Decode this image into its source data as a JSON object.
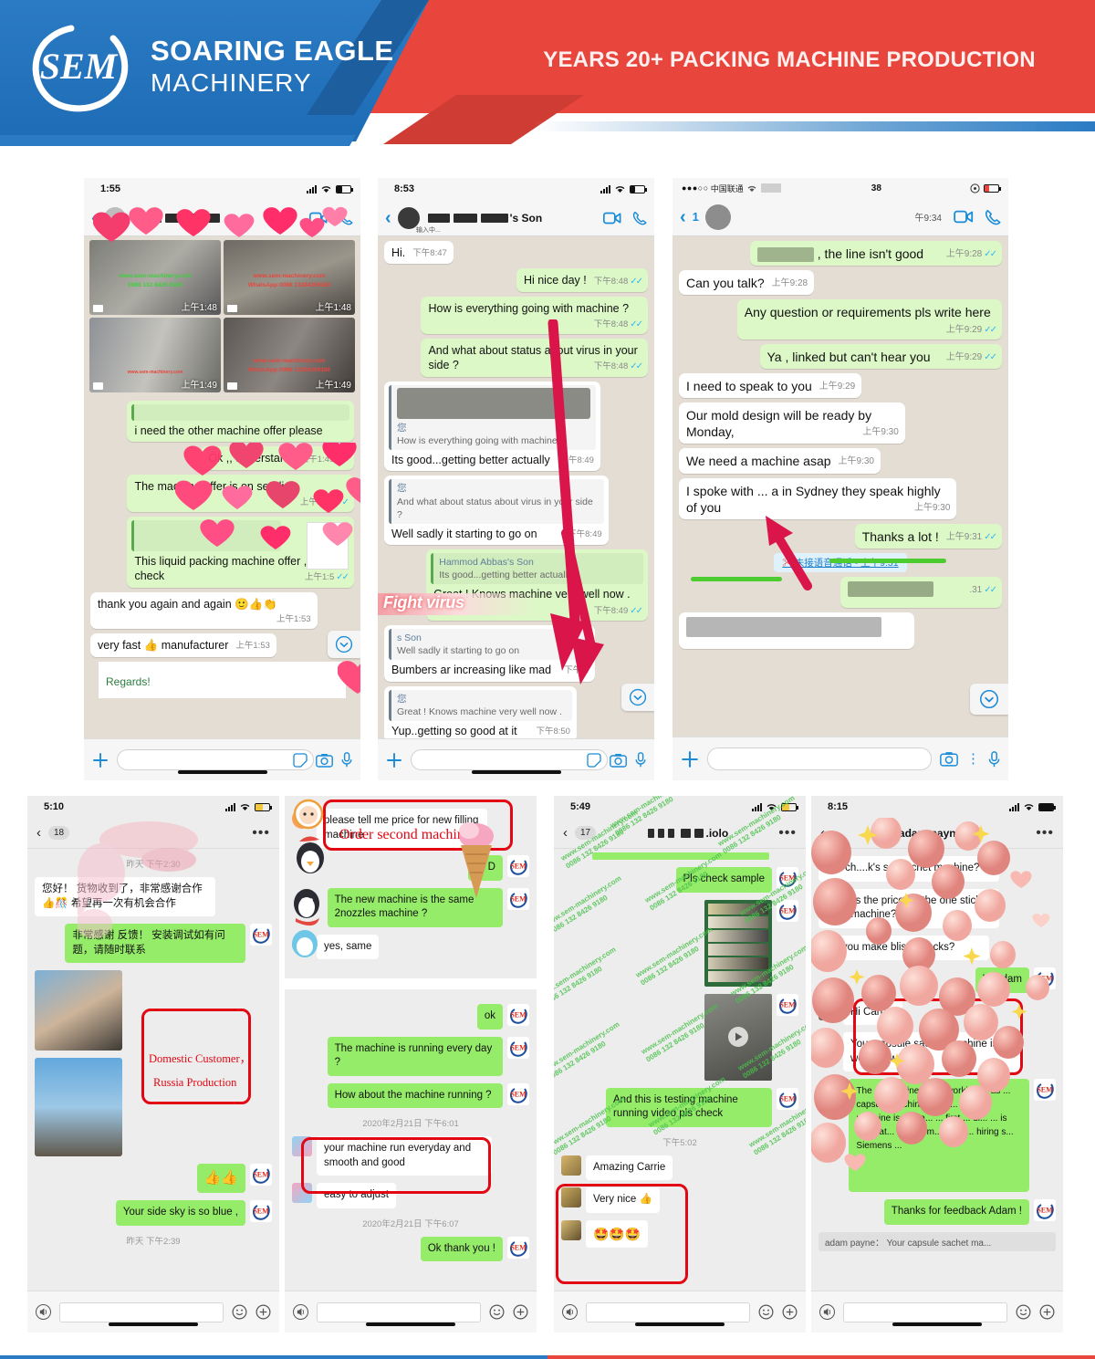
{
  "header": {
    "brand_line1": "SOARING EAGLE",
    "brand_line2": "MACHINERY",
    "logo_text": "SEM",
    "tagline": "YEARS 20+ PACKING MACHINE PRODUCTION",
    "colors": {
      "blue": "#2b7bc4",
      "blue_dark": "#1c5e9e",
      "red": "#e8453c",
      "red_dark": "#cf3c34"
    }
  },
  "watermark": {
    "site": "www.sem-machinery.com",
    "phone": "0086 132 8426 9180",
    "whatsapp": "WhatsApp:0086 13284269180"
  },
  "phones": [
    {
      "id": "phone1",
      "status": {
        "time": "1:55",
        "battery": "low"
      },
      "nav": {
        "back": "‹",
        "title_redacted": true,
        "icons": [
          "video-call-icon",
          "phone-call-icon"
        ]
      },
      "media": [
        {
          "time": "上午1:48",
          "wm1": "www.sem-machinery.com",
          "wm2": "0086 132 8426 9180"
        },
        {
          "time": "上午1:48",
          "wm1": "www.sem-machinery.com",
          "wm2": "WhatsApp:0086 13284269180"
        },
        {
          "time": "上午1:49",
          "wm1": "www.sem-machinery.com",
          "wm2": "0086 132 8426 9180"
        },
        {
          "time": "上午1:49",
          "wm1": "www.sem-machinery.com",
          "wm2": "WhatsApp:0086 13284269180"
        }
      ],
      "messages": [
        {
          "side": "out",
          "quote": "i need the other machine offer please",
          "text": "",
          "time": ""
        },
        {
          "side": "out",
          "text": "Ok ,, understand",
          "time": "上午1:49",
          "ticks": true
        },
        {
          "side": "out",
          "text": "The machine offer is on sending",
          "time": "上午1:49",
          "ticks": true
        },
        {
          "side": "out",
          "text": "This liquid packing machine offer , pls check",
          "time": "上午1:5",
          "ticks": true,
          "has_doc": true
        },
        {
          "side": "in",
          "text": "thank you again and again  🙂👍👏",
          "time": "上午1:53"
        },
        {
          "side": "in",
          "text": "very fast 👍 manufacturer",
          "time": "上午1:53"
        },
        {
          "side": "in",
          "text": "Regards!",
          "time": "",
          "is_doc_preview": true
        }
      ]
    },
    {
      "id": "phone2",
      "status": {
        "time": "8:53",
        "battery": "low"
      },
      "nav": {
        "back": "‹",
        "title": "'s Son",
        "subtitle": "输入中...",
        "icons": [
          "video-call-icon",
          "phone-call-icon"
        ]
      },
      "annotation": {
        "fight_virus": "Fight virus"
      },
      "messages": [
        {
          "side": "in",
          "text": "Hi.",
          "time": "下午8:47"
        },
        {
          "side": "out",
          "text": "Hi nice day !",
          "time": "下午8:48",
          "ticks": true
        },
        {
          "side": "out",
          "text": "How is everything going with machine ?",
          "time": "下午8:48",
          "ticks": true
        },
        {
          "side": "out",
          "text": "And what about status about virus in your side ?",
          "time": "下午8:48",
          "ticks": true
        },
        {
          "side": "in",
          "quote_name": "您",
          "quote": "How is everything going with machine ?",
          "text": "Its good...getting better actually",
          "time": "下午8:49",
          "has_image_quote": true
        },
        {
          "side": "in",
          "quote_name": "您",
          "quote": "And what about status about virus in your side ?",
          "text": "Well sadly it starting to go on",
          "time": "下午8:49"
        },
        {
          "side": "out",
          "quote_name": "Hammod Abbas's Son",
          "quote": "Its good...getting better actually",
          "text": "Great ! Knows machine very well now .",
          "time": "下午8:49",
          "ticks": true
        },
        {
          "side": "in",
          "quote_name": "s Son",
          "quote": "Well sadly it starting to go on",
          "text": "Bumbers ar increasing  like mad",
          "time": "下午8:"
        },
        {
          "side": "in",
          "quote_name": "您",
          "quote": "Great ! Knows machine very well now .",
          "text": "Yup..getting so good at it",
          "time": "下午8:50"
        }
      ]
    },
    {
      "id": "phone3",
      "status": {
        "carrier": "中国联通",
        "time": "38",
        "battery": "red"
      },
      "nav": {
        "back": "‹",
        "badge": "1",
        "title_redacted": true,
        "header_time": "午9:34",
        "icons": [
          "video-call-icon",
          "phone-call-icon"
        ]
      },
      "messages": [
        {
          "side": "out",
          "text": ", the line isn't good",
          "time": "上午9:28",
          "ticks": true,
          "scribble": true
        },
        {
          "side": "in",
          "text": "Can you talk?",
          "time": "上午9:28"
        },
        {
          "side": "out",
          "text": "Any question or requirements pls write here",
          "time": "上午9:29",
          "ticks": true
        },
        {
          "side": "out",
          "text": "Ya , linked but can't hear you",
          "time": "上午9:29",
          "ticks": true
        },
        {
          "side": "in",
          "text": "I need to speak to you",
          "time": "上午9:29"
        },
        {
          "side": "in",
          "text": "Our mold design will be ready by Monday,",
          "time": "上午9:30"
        },
        {
          "side": "in",
          "text": "We need a machine asap",
          "time": "上午9:30"
        },
        {
          "side": "in",
          "text": "I spoke with ... a in Sydney they speak highly of you",
          "time": "上午9:30",
          "highlight": true
        },
        {
          "side": "out",
          "text": "Thanks a lot !",
          "time": "上午9:31",
          "ticks": true
        },
        {
          "side": "system",
          "text": "未接语音通话 - 上午9:31"
        },
        {
          "side": "out",
          "text": "",
          "time": ".31",
          "ticks": true,
          "scribble": true
        },
        {
          "side": "in",
          "text": "",
          "scribble": true
        }
      ]
    },
    {
      "id": "phone4",
      "app": "wechat",
      "status": {
        "time": "5:10",
        "battery": "yellow"
      },
      "nav": {
        "back": "‹",
        "count": "18",
        "dots": "•••"
      },
      "annotation": {
        "line1": "Domestic Customer，",
        "line2": "Russia Production"
      },
      "messages": [
        {
          "type": "time",
          "text": "昨天 下午2:30"
        },
        {
          "side": "in",
          "text": "您好！ 货物收到了，非常感谢合作👍🎊 希望再一次有机会合作"
        },
        {
          "side": "out",
          "text": "非常感谢 反馈！ 安装调试如有问题，请随时联系"
        },
        {
          "side": "in",
          "type": "photo",
          "caption": "forklift-container-photo"
        },
        {
          "side": "in",
          "type": "photo",
          "caption": "crane-container-photo"
        },
        {
          "side": "out",
          "text": "👍👍"
        },
        {
          "side": "out",
          "text": "Your side sky is so blue ,"
        },
        {
          "type": "time",
          "text": "昨天 下午2:39"
        }
      ]
    },
    {
      "id": "phone5",
      "app": "wechat",
      "annotation": {
        "box1_label": "Order second machine"
      },
      "messages_top": [
        {
          "side": "in",
          "text": "please tell me price for new filling machine"
        },
        {
          "side": "out",
          "text": "Hi D"
        },
        {
          "side": "out",
          "text": "The new machine is the same 2nozzles machine ?"
        },
        {
          "side": "in",
          "text": "yes, same"
        }
      ],
      "messages_bottom": [
        {
          "side": "out",
          "text": "ok"
        },
        {
          "side": "out",
          "text": "The machine is running every day ?"
        },
        {
          "side": "out",
          "text": "How about the machine running ?"
        },
        {
          "type": "time",
          "text": "2020年2月21日 下午6:01"
        },
        {
          "side": "in",
          "text": "your machine run everyday and smooth and good"
        },
        {
          "side": "in",
          "text": "easy to adjust"
        },
        {
          "type": "time",
          "text": "2020年2月21日 下午6:07"
        },
        {
          "side": "out",
          "text": "Ok thank you !"
        }
      ]
    },
    {
      "id": "phone6",
      "app": "wechat",
      "status": {
        "time": "5:49",
        "battery": "yellow"
      },
      "nav": {
        "back": "‹",
        "count": "17",
        "title": ".iolo",
        "dots": "•••"
      },
      "messages": [
        {
          "side": "out",
          "text": "Pls check sample"
        },
        {
          "side": "out",
          "type": "photo",
          "caption": "stick-pack-samples-photo"
        },
        {
          "side": "out",
          "type": "video",
          "caption": "machine-running-video"
        },
        {
          "side": "out",
          "text": "And this is testing machine running video pls check"
        },
        {
          "type": "time",
          "text": "下午5:02"
        },
        {
          "side": "in",
          "text": "Amazing Carrie"
        },
        {
          "side": "in",
          "text": "Very nice 👍"
        },
        {
          "side": "in",
          "text": "🤩🤩🤩"
        }
      ]
    },
    {
      "id": "phone7",
      "app": "wechat",
      "status": {
        "time": "8:15",
        "battery": "full"
      },
      "nav": {
        "back": "‹",
        "title": "adam payne",
        "dots": "•••"
      },
      "messages": [
        {
          "side": "in",
          "text": "H... ch....k's s... sachet machine?"
        },
        {
          "side": "in",
          "text": "What is the price for the one stick pack machine?"
        },
        {
          "side": "in",
          "text": "Do you make blister packs?"
        },
        {
          "side": "out",
          "text": "Hi Adam"
        },
        {
          "side": "in",
          "text": "Hi Carrie!"
        },
        {
          "side": "in",
          "text": "Your capsule sachet machine is still working wel"
        },
        {
          "side": "out",
          "text": "The ... machine is still working ... as ... capsule machine ... 50 ... The ... machine is ... ma... ... first ... di... ... is integrat... ... ... com... ... Ch... hiring s... Siemens ..."
        },
        {
          "side": "out",
          "text": "Thanks for feedback Adam !"
        }
      ],
      "preview": "adam payne：  Your capsule sachet ma..."
    }
  ]
}
